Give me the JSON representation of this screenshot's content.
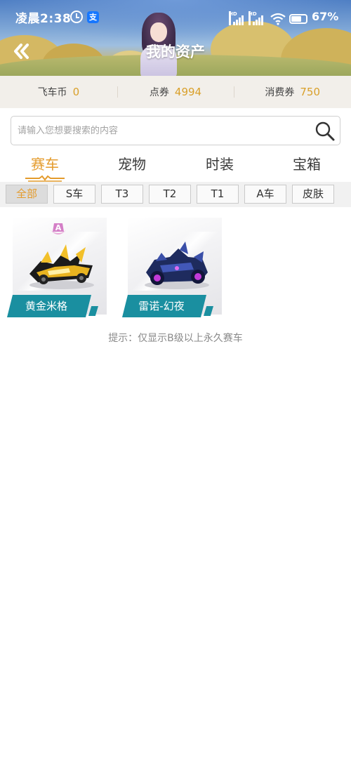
{
  "status_bar": {
    "time": "凌晨2:38",
    "battery": "67%",
    "network_label": "HD",
    "icons": [
      "alarm-icon",
      "alipay-icon",
      "signal-icon",
      "signal-icon",
      "wifi-icon",
      "battery-icon"
    ]
  },
  "header": {
    "title": "我的资产",
    "back_icon": "double-chevron-left-icon"
  },
  "currencies": [
    {
      "label": "飞车币",
      "value": "0"
    },
    {
      "label": "点券",
      "value": "4994"
    },
    {
      "label": "消费券",
      "value": "750"
    }
  ],
  "search": {
    "placeholder": "请输入您想要搜索的内容",
    "value": ""
  },
  "tabs": [
    {
      "label": "赛车",
      "active": true
    },
    {
      "label": "宠物",
      "active": false
    },
    {
      "label": "时装",
      "active": false
    },
    {
      "label": "宝箱",
      "active": false
    }
  ],
  "filters": [
    {
      "label": "全部",
      "active": true
    },
    {
      "label": "S车",
      "active": false
    },
    {
      "label": "T3",
      "active": false
    },
    {
      "label": "T2",
      "active": false
    },
    {
      "label": "T1",
      "active": false
    },
    {
      "label": "A车",
      "active": false
    },
    {
      "label": "皮肤",
      "active": false
    }
  ],
  "cars": [
    {
      "name": "黄金米格",
      "rank_badge": "A"
    },
    {
      "name": "雷诺-幻夜",
      "rank_badge": ""
    }
  ],
  "hint": "提示：仅显示B级以上永久赛车",
  "colors": {
    "accent": "#e49b2c",
    "card_label": "#1a8fa0",
    "currency_bar": "#f2efea"
  }
}
